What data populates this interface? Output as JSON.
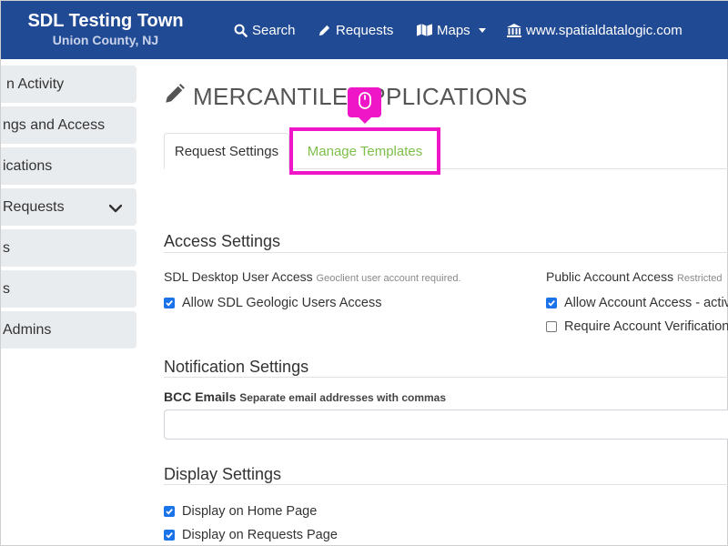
{
  "header": {
    "title": "SDL Testing Town",
    "subtitle": "Union County, NJ",
    "nav": {
      "search": "Search",
      "requests": "Requests",
      "maps": "Maps",
      "website": "www.spatialdatalogic.com"
    }
  },
  "sidebar": {
    "items": [
      {
        "label": "n Activity"
      },
      {
        "label": "ngs and Access"
      },
      {
        "label": "ications"
      },
      {
        "label": "Requests"
      },
      {
        "label": "s"
      },
      {
        "label": "s"
      },
      {
        "label": "Admins"
      }
    ]
  },
  "main": {
    "title": "MERCANTILE APPLICATIONS",
    "tabs": [
      {
        "label": "Request Settings"
      },
      {
        "label": "Manage Templates"
      }
    ],
    "access": {
      "heading": "Access Settings",
      "desktop_label": "SDL Desktop User Access",
      "desktop_note": "Geoclient user account required.",
      "desktop_checkbox": "Allow SDL Geologic Users Access",
      "public_label": "Public Account Access",
      "public_note": "Restricted",
      "public_checkbox_1": "Allow Account Access - active",
      "public_checkbox_2": "Require Account Verification"
    },
    "notification": {
      "heading": "Notification Settings",
      "bcc_label": "BCC Emails",
      "bcc_note": "Separate email addresses with commas",
      "bcc_value": ""
    },
    "display": {
      "heading": "Display Settings",
      "home_checkbox": "Display on Home Page",
      "requests_checkbox": "Display on Requests Page"
    }
  },
  "colors": {
    "navbar": "#214a94",
    "highlight": "#ee16c7",
    "tab_link": "#7cbf4a",
    "checkbox": "#1a73e8"
  },
  "icons": [
    "search-icon",
    "pencil-icon",
    "map-icon",
    "bank-icon",
    "chevron-down-icon",
    "mouse-icon",
    "check-icon"
  ]
}
